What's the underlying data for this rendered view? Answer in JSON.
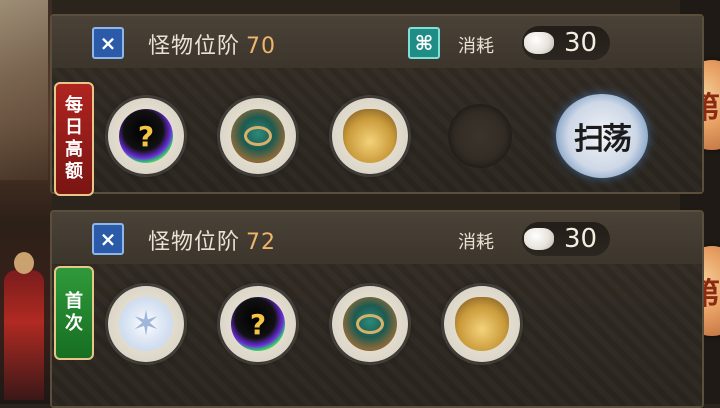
{
  "panels": [
    {
      "title": "怪物位阶",
      "tier": "70",
      "cost_label": "消耗",
      "cost_value": "30",
      "tag": "每日高额",
      "tag_chars": [
        "每",
        "日",
        "高",
        "额"
      ],
      "items": [
        {
          "icon": "mystery-orb-icon"
        },
        {
          "icon": "spirit-creature-icon"
        },
        {
          "icon": "potion-bottle-icon"
        }
      ],
      "action_label": "扫荡"
    },
    {
      "title": "怪物位阶",
      "tier": "72",
      "cost_label": "消耗",
      "cost_value": "30",
      "tag": "首次",
      "tag_chars": [
        "首",
        "次"
      ],
      "items": [
        {
          "icon": "crystal-star-icon"
        },
        {
          "icon": "mystery-orb-icon"
        },
        {
          "icon": "spirit-creature-icon"
        },
        {
          "icon": "potion-bottle-icon"
        }
      ]
    }
  ],
  "colors": {
    "tier_number": "#f0b46a",
    "tag_daily": "#b02420",
    "tag_first": "#2f9a3a",
    "header_icon": "#2a5aa8"
  }
}
